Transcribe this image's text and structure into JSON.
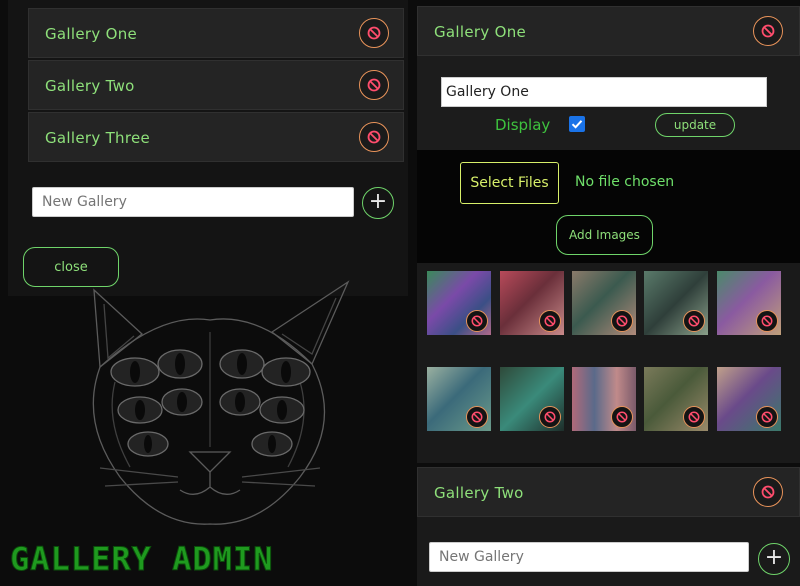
{
  "app": {
    "logo_text": "GALLERY ADMIN"
  },
  "gallery_list": {
    "items": [
      {
        "label": "Gallery One"
      },
      {
        "label": "Gallery Two"
      },
      {
        "label": "Gallery Three"
      }
    ],
    "new_gallery_placeholder": "New Gallery",
    "add_icon": "plus-icon",
    "delete_icon": "ban-icon",
    "close_label": "close"
  },
  "editor": {
    "title": "Gallery One",
    "name_value": "Gallery One",
    "display_label": "Display",
    "display_checked": true,
    "update_label": "update",
    "select_files_label": "Select Files",
    "file_status": "No file chosen",
    "add_images_label": "Add Images",
    "image_count": 10
  },
  "collapsed_gallery": {
    "title": "Gallery Two"
  },
  "footer": {
    "new_gallery_placeholder": "New Gallery"
  },
  "colors": {
    "accent_green": "#8ee07a",
    "delete_orange": "#e8935a",
    "select_files_yellow": "#d8f06a",
    "checkbox_blue": "#1a73e8",
    "logo_green": "#1f9a1f"
  }
}
